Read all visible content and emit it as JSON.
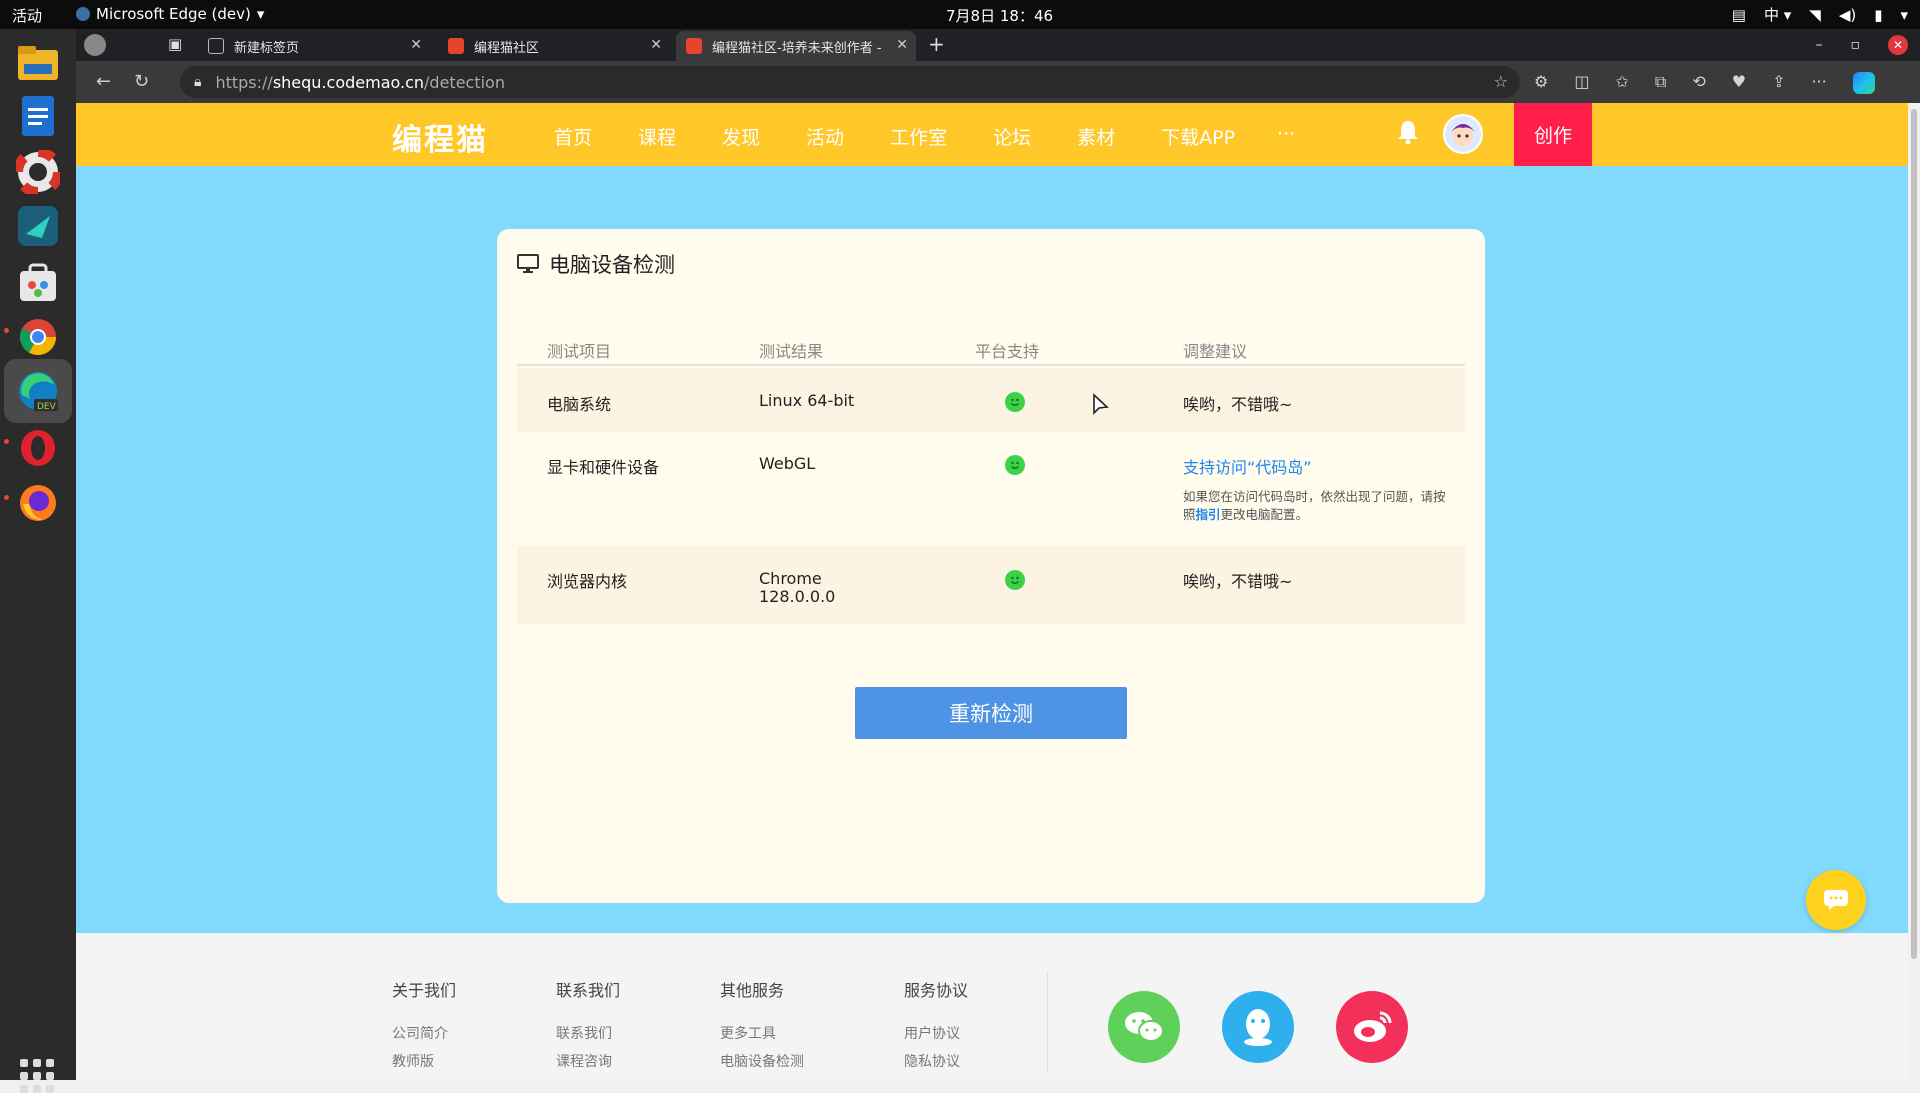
{
  "topbar": {
    "activities": "活动",
    "app_name": "Microsoft Edge (dev)",
    "clock": "7月8日 18：46",
    "ime": "中"
  },
  "tabs": [
    {
      "label": "新建标签页"
    },
    {
      "label": "编程猫社区"
    },
    {
      "label": "编程猫社区-培养未来创作者 -"
    }
  ],
  "address": {
    "url_scheme": "https://",
    "url_host": "shequ.codemao.cn",
    "url_path": "/detection"
  },
  "site_nav": {
    "logo": "编程猫",
    "links": [
      "首页",
      "课程",
      "发现",
      "活动",
      "工作室",
      "论坛",
      "素材",
      "下载APP",
      "···"
    ],
    "create": "创作"
  },
  "detection": {
    "title": "电脑设备检测",
    "headers": [
      "测试项目",
      "测试结果",
      "平台支持",
      "调整建议"
    ],
    "rows": [
      {
        "item": "电脑系统",
        "result": "Linux 64-bit",
        "result2": "",
        "advice": "唉哟，不错哦~"
      },
      {
        "item": "显卡和硬件设备",
        "result": "WebGL",
        "result2": "",
        "advice": "支持访问“代码岛”",
        "note_pre": "如果您在访问代码岛时，依然出现了问题，请按",
        "note_link": "指引",
        "note_post": "更改电脑配置。",
        "note_line1": "照"
      },
      {
        "item": "浏览器内核",
        "result": "Chrome",
        "result2": "128.0.0.0",
        "advice": "唉哟，不错哦~"
      }
    ],
    "retest": "重新检测"
  },
  "footer": {
    "cols": [
      {
        "head": "关于我们",
        "items": [
          "公司简介",
          "教师版"
        ]
      },
      {
        "head": "联系我们",
        "items": [
          "联系我们",
          "课程咨询"
        ]
      },
      {
        "head": "其他服务",
        "items": [
          "更多工具",
          "电脑设备检测"
        ]
      },
      {
        "head": "服务协议",
        "items": [
          "用户协议",
          "隐私协议"
        ]
      }
    ]
  },
  "colors": {
    "nav_yellow": "#ffc728",
    "page_blue": "#81d9fb",
    "create_red": "#ff1f4a",
    "button_blue": "#4f93e4",
    "ok_green": "#3bd24a"
  }
}
